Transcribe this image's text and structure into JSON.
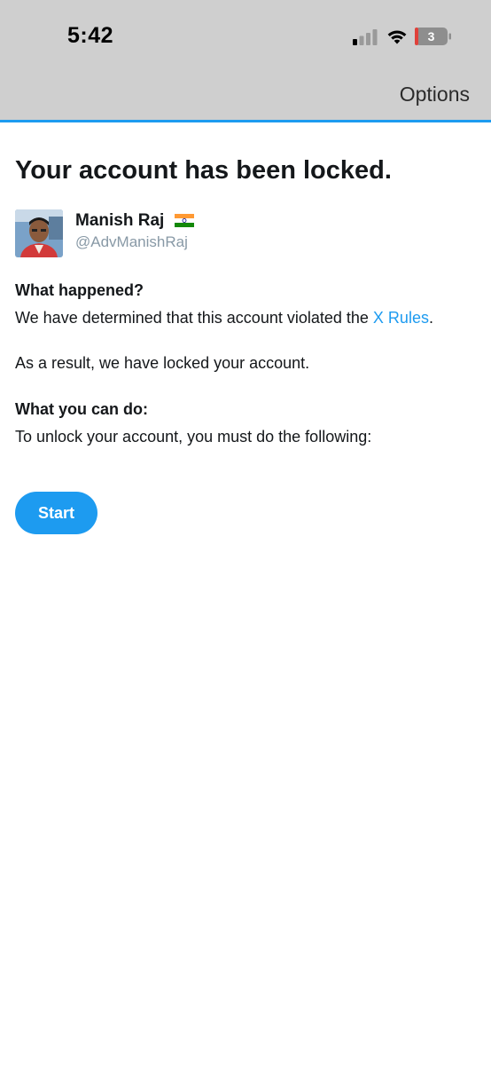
{
  "status_bar": {
    "time": "5:42",
    "battery_level": "3",
    "signal_bars_active": 1,
    "signal_bars_total": 4
  },
  "header": {
    "options_label": "Options",
    "accent_color": "#1d9bf0"
  },
  "main": {
    "title": "Your account has been locked.",
    "user": {
      "name": "Manish Raj",
      "flag_icon": "india-flag-icon",
      "handle": "@AdvManishRaj"
    },
    "what_happened": {
      "heading": "What happened?",
      "text_before_link": "We have determined that this account violated the ",
      "link_text": "X Rules",
      "text_after_link": "."
    },
    "result_text": "As a result, we have locked your account.",
    "what_you_can_do": {
      "heading": "What you can do:",
      "text": "To unlock your account, you must do the following:"
    },
    "start_button_label": "Start"
  }
}
